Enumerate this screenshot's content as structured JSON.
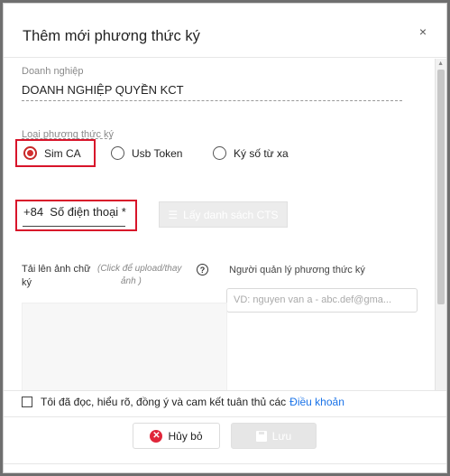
{
  "dialog": {
    "title": "Thêm mới phương thức ký",
    "close_glyph": "×"
  },
  "company": {
    "label": "Doanh nghiệp",
    "value": "DOANH NGHIỆP QUYỀN KCT"
  },
  "sign_method": {
    "label": "Loại phương thức ký",
    "options": [
      {
        "label": "Sim CA",
        "selected": true
      },
      {
        "label": "Usb Token",
        "selected": false
      },
      {
        "label": "Ký số từ xa",
        "selected": false
      }
    ]
  },
  "phone": {
    "prefix": "+84",
    "placeholder": "Số điện thoại *"
  },
  "cts_button": {
    "label": "Lấy danh sách CTS",
    "icon": "list-icon"
  },
  "upload": {
    "label_line1": "Tải lên ảnh chữ",
    "label_line2": "ký",
    "hint_line1": "(Click để upload/thay",
    "hint_line2": "ảnh )",
    "help_glyph": "?"
  },
  "manager": {
    "label": "Người quản lý phương thức ký",
    "placeholder": "VD: nguyen van a - abc.def@gma..."
  },
  "terms": {
    "text": "Tôi đã đọc, hiểu rõ, đồng ý và cam kết tuân thủ các",
    "link": "Điều khoản"
  },
  "footer": {
    "cancel_label": "Hủy bỏ",
    "save_label": "Lưu"
  },
  "colors": {
    "highlight_red": "#d8142a",
    "link_blue": "#1a73e8",
    "radio_red": "#d32f2f"
  }
}
